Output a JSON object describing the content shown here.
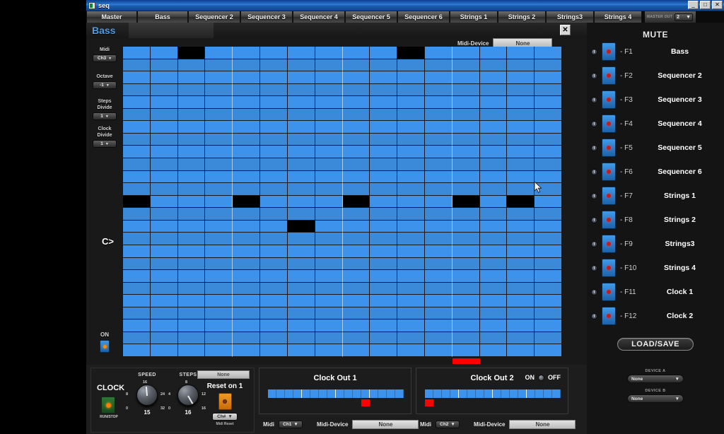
{
  "window": {
    "title": "seq",
    "icon": "app-icon",
    "buttons": {
      "minimize": "_",
      "maximize": "□",
      "close": "✕"
    }
  },
  "tabs": [
    {
      "label": "Master"
    },
    {
      "label": "Bass"
    },
    {
      "label": "Sequencer 2"
    },
    {
      "label": "Sequencer 3"
    },
    {
      "label": "Sequencer 4"
    },
    {
      "label": "Sequencer 5"
    },
    {
      "label": "Sequencer 6"
    },
    {
      "label": "Strings 1"
    },
    {
      "label": "Strings 2"
    },
    {
      "label": "Strings3"
    },
    {
      "label": "Strings 4"
    }
  ],
  "master_out": {
    "label": "MASTER OUT",
    "value": "2",
    "caret": "▼"
  },
  "sequencer": {
    "name": "Bass",
    "close_label": "✕",
    "midi_device": {
      "label": "Midi-Device",
      "value": "None"
    },
    "controls": [
      {
        "name": "Midi",
        "value": "Ch3",
        "caret": "▼"
      },
      {
        "name": "Octave",
        "value": "-1",
        "caret": "▼"
      },
      {
        "name": "Steps Divide",
        "line1": "Steps",
        "line2": "Divide",
        "value": "1",
        "caret": "▼"
      },
      {
        "name": "Clock Divide",
        "line1": "Clock",
        "line2": "Divide",
        "value": "1",
        "caret": "▼"
      }
    ],
    "on_label": "ON",
    "root_marker": "C>",
    "grid": {
      "columns": 16,
      "rows": 25,
      "root_row": 13,
      "active_cells": [
        {
          "row": 1,
          "col": 3
        },
        {
          "row": 1,
          "col": 11
        },
        {
          "row": 13,
          "col": 1
        },
        {
          "row": 13,
          "col": 5
        },
        {
          "row": 13,
          "col": 9
        },
        {
          "row": 13,
          "col": 13
        },
        {
          "row": 13,
          "col": 15
        },
        {
          "row": 15,
          "col": 7
        }
      ],
      "playhead_column": 13
    }
  },
  "mute_panel": {
    "title": "MUTE",
    "rows": [
      {
        "fkey": "- F1",
        "track": "Bass"
      },
      {
        "fkey": "- F2",
        "track": "Sequencer 2"
      },
      {
        "fkey": "- F3",
        "track": "Sequencer 3"
      },
      {
        "fkey": "- F4",
        "track": "Sequencer 4"
      },
      {
        "fkey": "- F5",
        "track": "Sequencer 5"
      },
      {
        "fkey": "- F6",
        "track": "Sequencer 6"
      },
      {
        "fkey": "- F7",
        "track": "Strings 1"
      },
      {
        "fkey": "- F8",
        "track": "Strings 2"
      },
      {
        "fkey": "- F9",
        "track": "Strings3"
      },
      {
        "fkey": "- F10",
        "track": "Strings 4"
      },
      {
        "fkey": "- F11",
        "track": "Clock 1"
      },
      {
        "fkey": "- F12",
        "track": "Clock 2"
      }
    ],
    "load_save": "LOAD/SAVE",
    "device_a": {
      "label": "DEVICE A",
      "value": "None",
      "caret": "▼"
    },
    "device_b": {
      "label": "DEVICE B",
      "value": "None",
      "caret": "▼"
    }
  },
  "clock": {
    "title": "CLOCK",
    "runstop_label": "RUN/STOP",
    "speed": {
      "label": "SPEED",
      "value": "15",
      "ticks": [
        "0",
        "8",
        "16",
        "24",
        "32"
      ]
    },
    "steps": {
      "label": "STEPS",
      "value": "16",
      "ticks": [
        "0",
        "4",
        "8",
        "12",
        "16"
      ]
    },
    "reset_device": "None",
    "reset_title": "Reset on 1",
    "reset_midi": {
      "value": "Ch#",
      "caret": "▼"
    },
    "reset_foot": "Midi Reset"
  },
  "clock_outs": [
    {
      "title": "Clock Out 1",
      "steps": 16,
      "marker_step": 12,
      "marker_position": "below",
      "midi_label": "Midi",
      "midi_value": "Ch1",
      "midi_caret": "▼",
      "device_label": "Midi-Device",
      "device_value": "None",
      "onoff": null
    },
    {
      "title": "Clock Out 2",
      "steps": 16,
      "marker_step": 1,
      "marker_position": "below",
      "midi_label": "Midi",
      "midi_value": "Ch2",
      "midi_caret": "▼",
      "device_label": "Midi-Device",
      "device_value": "None",
      "onoff": {
        "on": "ON",
        "off": "OFF"
      }
    }
  ],
  "colors": {
    "grid_blue": "#3d93eb",
    "active_black": "#000000",
    "playhead_red": "#ff0000",
    "accent_blue": "#4e9ae3",
    "led_red": "#c41b1b",
    "led_orange": "#ff7a00"
  }
}
